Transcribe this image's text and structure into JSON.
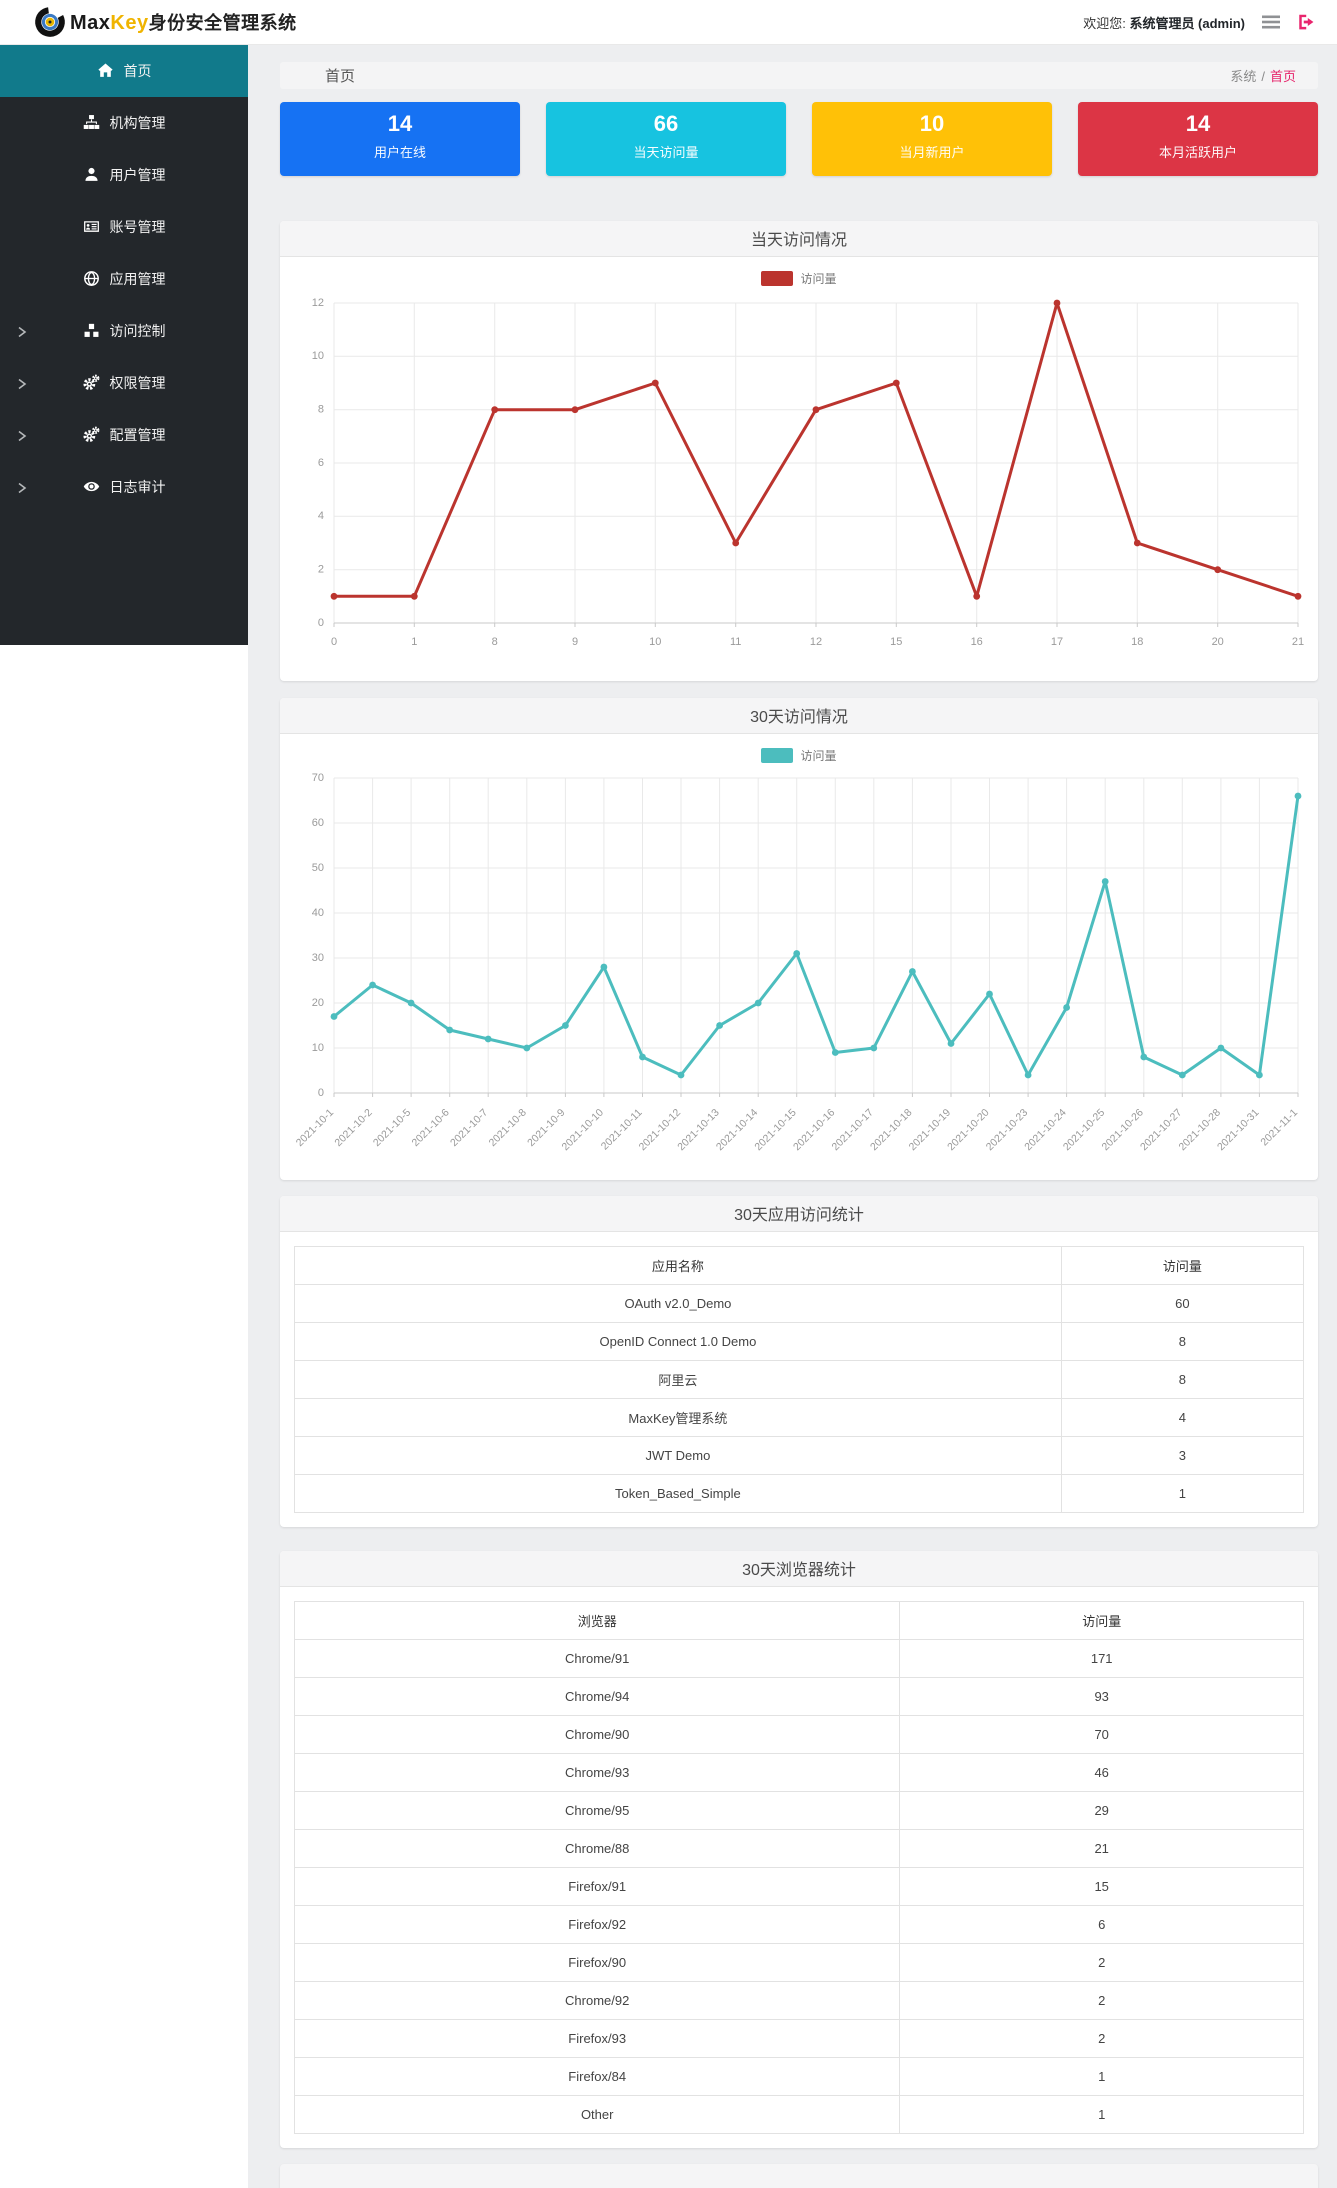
{
  "header": {
    "brand_max": "Max",
    "brand_key": "Key",
    "brand_suffix": "身份安全管理系统",
    "welcome_prefix": "欢迎您:",
    "welcome_user": "系统管理员 (admin)"
  },
  "sidebar": {
    "active_color": "#117a8b",
    "items": [
      {
        "label": "首页",
        "icon": "home-icon",
        "active": true,
        "expandable": false
      },
      {
        "label": "机构管理",
        "icon": "sitemap-icon",
        "active": false,
        "expandable": false
      },
      {
        "label": "用户管理",
        "icon": "user-icon",
        "active": false,
        "expandable": false
      },
      {
        "label": "账号管理",
        "icon": "idcard-icon",
        "active": false,
        "expandable": false
      },
      {
        "label": "应用管理",
        "icon": "globe-icon",
        "active": false,
        "expandable": false
      },
      {
        "label": "访问控制",
        "icon": "cubes-icon",
        "active": false,
        "expandable": true
      },
      {
        "label": "权限管理",
        "icon": "cogs-icon",
        "active": false,
        "expandable": true
      },
      {
        "label": "配置管理",
        "icon": "cogs-icon",
        "active": false,
        "expandable": true
      },
      {
        "label": "日志审计",
        "icon": "eye-icon",
        "active": false,
        "expandable": true
      }
    ]
  },
  "breadcrumb": {
    "page_title": "首页",
    "root": "系统",
    "separator": "/",
    "current": "首页",
    "current_color": "#e6246b"
  },
  "stat_cards": [
    {
      "value": "14",
      "label": "用户在线",
      "color": "#1672f3"
    },
    {
      "value": "66",
      "label": "当天访问量",
      "color": "#17c3e0"
    },
    {
      "value": "10",
      "label": "当月新用户",
      "color": "#ffc107"
    },
    {
      "value": "14",
      "label": "本月活跃用户",
      "color": "#dc3545"
    }
  ],
  "chart_data": [
    {
      "type": "line",
      "title": "当天访问情况",
      "legend": "访问量",
      "legend_position": "top-center",
      "color": "#bb342e",
      "categories": [
        "0",
        "1",
        "8",
        "9",
        "10",
        "11",
        "12",
        "15",
        "16",
        "17",
        "18",
        "20",
        "21"
      ],
      "values": [
        1,
        1,
        8,
        8,
        9,
        3,
        8,
        9,
        1,
        12,
        3,
        2,
        1
      ],
      "xlabel": "",
      "ylabel": "",
      "ylim": [
        0,
        12
      ],
      "ytick_step": 2,
      "grid": true,
      "rotate_x_labels": 0
    },
    {
      "type": "line",
      "title": "30天访问情况",
      "legend": "访问量",
      "legend_position": "top-center",
      "color": "#4cbdbe",
      "categories": [
        "2021-10-1",
        "2021-10-2",
        "2021-10-5",
        "2021-10-6",
        "2021-10-7",
        "2021-10-8",
        "2021-10-9",
        "2021-10-10",
        "2021-10-11",
        "2021-10-12",
        "2021-10-13",
        "2021-10-14",
        "2021-10-15",
        "2021-10-16",
        "2021-10-17",
        "2021-10-18",
        "2021-10-19",
        "2021-10-20",
        "2021-10-23",
        "2021-10-24",
        "2021-10-25",
        "2021-10-26",
        "2021-10-27",
        "2021-10-28",
        "2021-10-31",
        "2021-11-1"
      ],
      "values": [
        17,
        24,
        20,
        14,
        12,
        10,
        15,
        28,
        8,
        4,
        15,
        20,
        31,
        9,
        10,
        27,
        11,
        22,
        4,
        19,
        47,
        8,
        4,
        10,
        4,
        66
      ],
      "xlabel": "",
      "ylabel": "",
      "ylim": [
        0,
        70
      ],
      "ytick_step": 10,
      "grid": true,
      "rotate_x_labels": 45
    }
  ],
  "tables": [
    {
      "title": "30天应用访问统计",
      "headers": [
        "应用名称",
        "访问量"
      ],
      "rows": [
        [
          "OAuth v2.0_Demo",
          "60"
        ],
        [
          "OpenID Connect 1.0 Demo",
          "8"
        ],
        [
          "阿里云",
          "8"
        ],
        [
          "MaxKey管理系统",
          "4"
        ],
        [
          "JWT Demo",
          "3"
        ],
        [
          "Token_Based_Simple",
          "1"
        ]
      ]
    },
    {
      "title": "30天浏览器统计",
      "headers": [
        "浏览器",
        "访问量"
      ],
      "rows": [
        [
          "Chrome/91",
          "171"
        ],
        [
          "Chrome/94",
          "93"
        ],
        [
          "Chrome/90",
          "70"
        ],
        [
          "Chrome/93",
          "46"
        ],
        [
          "Chrome/95",
          "29"
        ],
        [
          "Chrome/88",
          "21"
        ],
        [
          "Firefox/91",
          "15"
        ],
        [
          "Firefox/92",
          "6"
        ],
        [
          "Firefox/90",
          "2"
        ],
        [
          "Chrome/92",
          "2"
        ],
        [
          "Firefox/93",
          "2"
        ],
        [
          "Firefox/84",
          "1"
        ],
        [
          "Other",
          "1"
        ]
      ]
    }
  ]
}
